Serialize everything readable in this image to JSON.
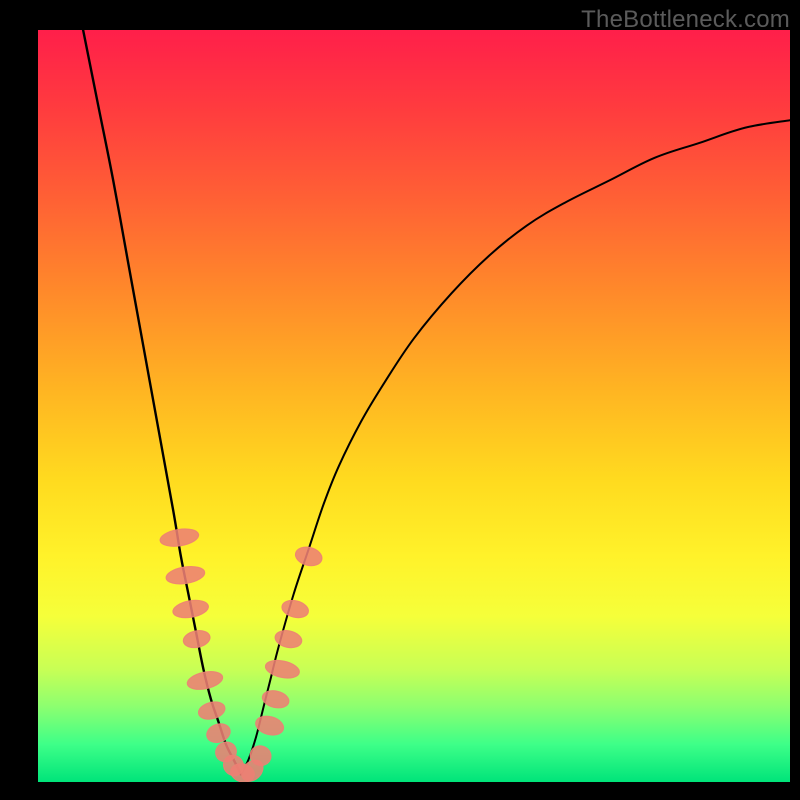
{
  "watermark": "TheBottleneck.com",
  "chart_data": {
    "type": "line",
    "title": "",
    "xlabel": "",
    "ylabel": "",
    "xlim": [
      0,
      100
    ],
    "ylim": [
      0,
      100
    ],
    "grid": false,
    "legend": false,
    "series": [
      {
        "name": "bottleneck-curve-left",
        "x": [
          6,
          8,
          10,
          12,
          14,
          16,
          18,
          19,
          20,
          21,
          22,
          23,
          24,
          25,
          26,
          27
        ],
        "y": [
          100,
          90,
          80,
          69,
          58,
          47,
          36,
          30,
          25,
          20,
          15,
          11,
          8,
          5,
          3,
          1
        ]
      },
      {
        "name": "bottleneck-curve-right",
        "x": [
          27,
          28,
          29,
          30,
          31,
          32,
          34,
          36,
          38,
          40,
          43,
          46,
          50,
          55,
          60,
          65,
          70,
          76,
          82,
          88,
          94,
          100
        ],
        "y": [
          1,
          3,
          6,
          10,
          14,
          18,
          25,
          31,
          37,
          42,
          48,
          53,
          59,
          65,
          70,
          74,
          77,
          80,
          83,
          85,
          87,
          88
        ]
      }
    ],
    "markers": {
      "name": "highlighted-points",
      "points": [
        {
          "x": 18.8,
          "y": 32.5,
          "rx": 1.1,
          "ry": 2.6
        },
        {
          "x": 19.6,
          "y": 27.5,
          "rx": 1.1,
          "ry": 2.6
        },
        {
          "x": 20.3,
          "y": 23.0,
          "rx": 1.1,
          "ry": 2.4
        },
        {
          "x": 21.1,
          "y": 19.0,
          "rx": 1.1,
          "ry": 1.8
        },
        {
          "x": 22.2,
          "y": 13.5,
          "rx": 1.1,
          "ry": 2.4
        },
        {
          "x": 23.1,
          "y": 9.5,
          "rx": 1.1,
          "ry": 1.8
        },
        {
          "x": 24.0,
          "y": 6.5,
          "rx": 1.2,
          "ry": 1.6
        },
        {
          "x": 25.0,
          "y": 4.0,
          "rx": 1.3,
          "ry": 1.4
        },
        {
          "x": 26.0,
          "y": 2.2,
          "rx": 1.4,
          "ry": 1.3
        },
        {
          "x": 27.2,
          "y": 1.2,
          "rx": 1.6,
          "ry": 1.2
        },
        {
          "x": 28.5,
          "y": 1.5,
          "rx": 1.6,
          "ry": 1.2
        },
        {
          "x": 29.6,
          "y": 3.5,
          "rx": 1.3,
          "ry": 1.4
        },
        {
          "x": 30.8,
          "y": 7.5,
          "rx": 1.2,
          "ry": 1.9
        },
        {
          "x": 31.6,
          "y": 11.0,
          "rx": 1.1,
          "ry": 1.8
        },
        {
          "x": 32.5,
          "y": 15.0,
          "rx": 1.1,
          "ry": 2.3
        },
        {
          "x": 33.3,
          "y": 19.0,
          "rx": 1.1,
          "ry": 1.8
        },
        {
          "x": 34.2,
          "y": 23.0,
          "rx": 1.1,
          "ry": 1.8
        },
        {
          "x": 36.0,
          "y": 30.0,
          "rx": 1.2,
          "ry": 1.8
        }
      ]
    },
    "gradient_bands": [
      {
        "color": "#ff1f4a",
        "stop": 0
      },
      {
        "color": "#ffb522",
        "stop": 48
      },
      {
        "color": "#fff22a",
        "stop": 70
      },
      {
        "color": "#00e47a",
        "stop": 100
      }
    ]
  }
}
